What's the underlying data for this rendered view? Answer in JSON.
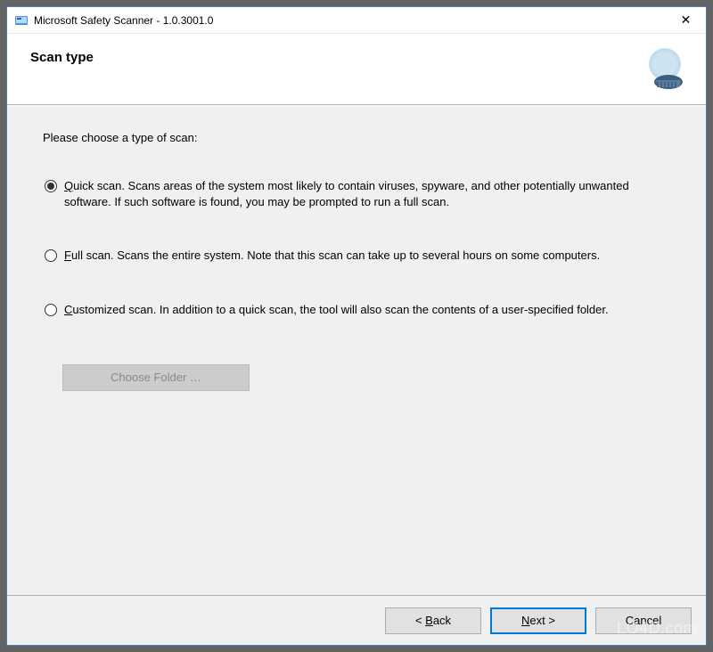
{
  "window": {
    "title": "Microsoft Safety Scanner - 1.0.3001.0",
    "close_label": "✕"
  },
  "header": {
    "title": "Scan type"
  },
  "content": {
    "prompt": "Please choose a type of scan:",
    "options": [
      {
        "id": "quick",
        "checked": true,
        "text": "Quick scan. Scans areas of the system most likely to contain viruses, spyware, and other potentially unwanted software. If such software is found, you may be prompted to run a full scan.",
        "accel_index": 0
      },
      {
        "id": "full",
        "checked": false,
        "text": "Full scan. Scans the entire system. Note that this scan can take up to several hours on some computers.",
        "accel_index": 0
      },
      {
        "id": "custom",
        "checked": false,
        "text": "Customized scan. In addition to a quick scan, the tool will also scan the contents of a user-specified folder.",
        "accel_index": 0
      }
    ],
    "choose_folder_label": "Choose Folder …",
    "choose_folder_enabled": false
  },
  "footer": {
    "back_label": "< Back",
    "back_accel": "B",
    "next_label": "Next >",
    "next_accel": "N",
    "cancel_label": "Cancel"
  },
  "watermark": "LO4D.com"
}
